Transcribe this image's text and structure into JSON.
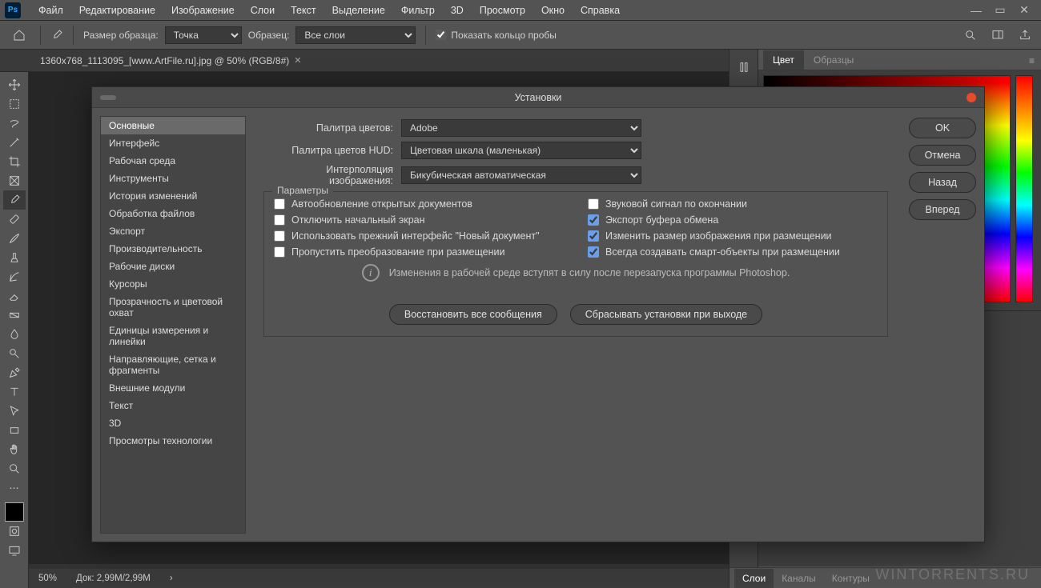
{
  "menubar": {
    "items": [
      "Файл",
      "Редактирование",
      "Изображение",
      "Слои",
      "Текст",
      "Выделение",
      "Фильтр",
      "3D",
      "Просмотр",
      "Окно",
      "Справка"
    ]
  },
  "optbar": {
    "sample_label": "Размер образца:",
    "sample_value": "Точка",
    "sample_from_label": "Образец:",
    "sample_from_value": "Все слои",
    "ring_label": "Показать кольцо пробы"
  },
  "tab": {
    "title": "1360x768_1113095_[www.ArtFile.ru].jpg @ 50% (RGB/8#)"
  },
  "tools": [
    "move",
    "marquee",
    "lasso",
    "wand",
    "crop",
    "frame",
    "eyedropper",
    "heal",
    "brush",
    "stamp",
    "history",
    "eraser",
    "gradient",
    "blur",
    "dodge",
    "pen",
    "type",
    "path",
    "rect",
    "hand",
    "zoom",
    "ellipsis",
    "dock",
    "screen"
  ],
  "status": {
    "zoom": "50%",
    "doc": "Док: 2,99M/2,99M"
  },
  "right": {
    "tab_color": "Цвет",
    "tab_swatches": "Образцы",
    "tab_layers": "Слои",
    "tab_channels": "Каналы",
    "tab_paths": "Контуры"
  },
  "dialog": {
    "title": "Установки",
    "categories": [
      "Основные",
      "Интерфейс",
      "Рабочая среда",
      "Инструменты",
      "История изменений",
      "Обработка файлов",
      "Экспорт",
      "Производительность",
      "Рабочие диски",
      "Курсоры",
      "Прозрачность и цветовой охват",
      "Единицы измерения и линейки",
      "Направляющие, сетка и фрагменты",
      "Внешние модули",
      "Текст",
      "3D",
      "Просмотры технологии"
    ],
    "rows": {
      "picker_label": "Палитра цветов:",
      "picker_value": "Adobe",
      "hud_label": "Палитра цветов HUD:",
      "hud_value": "Цветовая шкала (маленькая)",
      "interp_label": "Интерполяция изображения:",
      "interp_value": "Бикубическая автоматическая"
    },
    "fieldset_legend": "Параметры",
    "checks_left": [
      {
        "label": "Автообновление открытых документов",
        "checked": false
      },
      {
        "label": "Отключить начальный экран",
        "checked": false
      },
      {
        "label": "Использовать прежний интерфейс \"Новый документ\"",
        "checked": false
      },
      {
        "label": "Пропустить преобразование при размещении",
        "checked": false
      }
    ],
    "checks_right": [
      {
        "label": "Звуковой сигнал по окончании",
        "checked": false
      },
      {
        "label": "Экспорт буфера обмена",
        "checked": true
      },
      {
        "label": "Изменить размер изображения при размещении",
        "checked": true
      },
      {
        "label": "Всегда создавать смарт-объекты при размещении",
        "checked": true
      }
    ],
    "info_text": "Изменения в рабочей среде вступят в силу после перезапуска программы Photoshop.",
    "btn_reset_warnings": "Восстановить все сообщения",
    "btn_reset_on_quit": "Сбрасывать установки при выходе",
    "side": {
      "ok": "OK",
      "cancel": "Отмена",
      "prev": "Назад",
      "next": "Вперед"
    }
  },
  "watermark": "WINTORRENTS.RU"
}
